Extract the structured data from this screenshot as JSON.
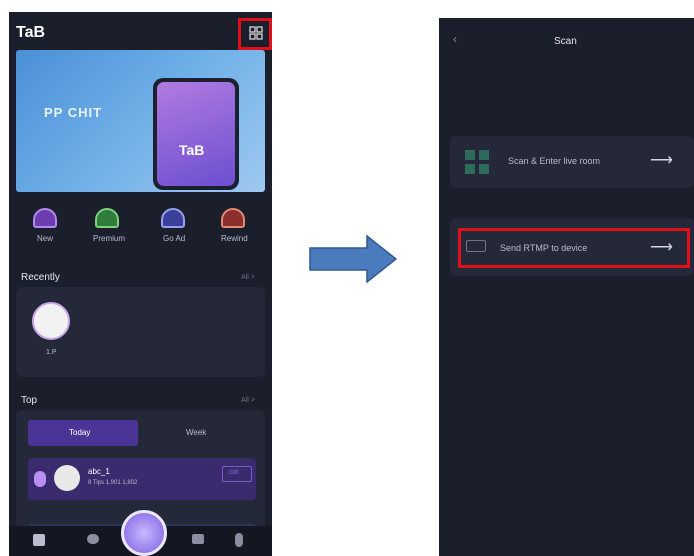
{
  "left_screen": {
    "app_title": "TaB",
    "banner": {
      "headline": "PP CHIT",
      "phone_label": "TaB"
    },
    "nav_items": [
      {
        "label": "New",
        "icon": "new-icon"
      },
      {
        "label": "Premium",
        "icon": "premium-icon"
      },
      {
        "label": "Go Ad",
        "icon": "go-ad-icon"
      },
      {
        "label": "Rewind",
        "icon": "rewind-icon"
      }
    ],
    "recently": {
      "title": "Recently",
      "more": "All >",
      "avatar_name": "1.P"
    },
    "top": {
      "title": "Top",
      "more": "All >",
      "tabs": [
        {
          "label": "Today"
        },
        {
          "label": "Week"
        }
      ],
      "entry": {
        "name": "abc_1",
        "stats": "8 Tips  1,901  1,802",
        "action": "Gift"
      }
    },
    "bottom_bar": [
      "home-icon",
      "chat-icon",
      "play-icon",
      "message-icon",
      "profile-icon"
    ]
  },
  "right_screen": {
    "title": "Scan",
    "rows": [
      {
        "label": "Scan & Enter live room",
        "icon": "qr-scan-icon"
      },
      {
        "label": "Send RTMP to device",
        "icon": "rtmp-icon"
      }
    ]
  },
  "colors": {
    "highlight": "#e0101a",
    "arrow": "#4a7bbd",
    "phone_bg": "#1b1e2b",
    "card_bg": "#242838",
    "purple": "#5a3ea8"
  }
}
